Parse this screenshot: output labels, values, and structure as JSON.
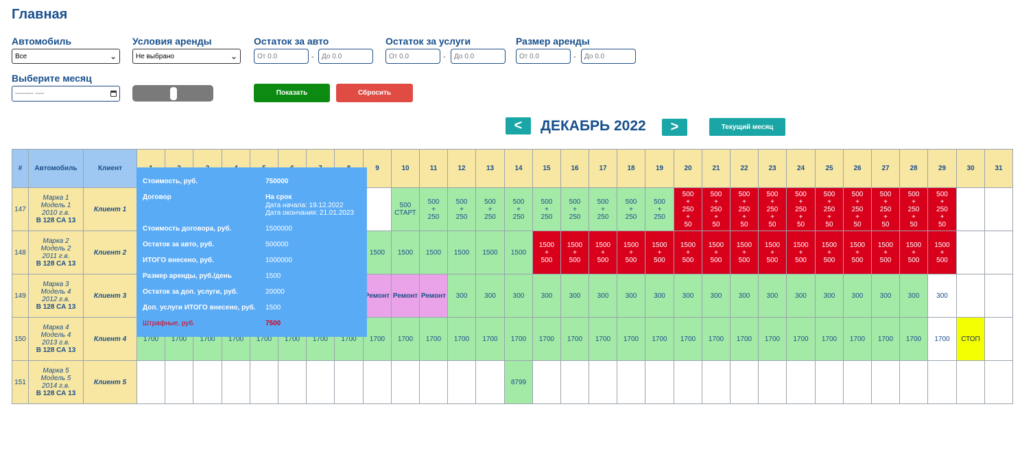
{
  "page": {
    "title": "Главная"
  },
  "filters": {
    "car_label": "Автомобиль",
    "car_value": "Все",
    "terms_label": "Условия аренды",
    "terms_value": "Не выбрано",
    "car_rest_label": "Остаток за авто",
    "services_rest_label": "Остаток за услуги",
    "rent_size_label": "Размер аренды",
    "from_placeholder": "От 0.0",
    "to_placeholder": "До 0.0",
    "dash": "-",
    "month_label": "Выберите месяц",
    "month_value": "-------- ----",
    "show_button": "Показать",
    "reset_button": "Сбросить"
  },
  "calendar": {
    "prev": "<",
    "next": ">",
    "title": "ДЕКАБРЬ 2022",
    "current_button": "Текущий месяц"
  },
  "table": {
    "headers": {
      "id": "#",
      "car": "Автомобиль",
      "client": "Клиент"
    },
    "days": [
      "1",
      "2",
      "3",
      "4",
      "5",
      "6",
      "7",
      "8",
      "9",
      "10",
      "11",
      "12",
      "13",
      "14",
      "15",
      "16",
      "17",
      "18",
      "19",
      "20",
      "21",
      "22",
      "23",
      "24",
      "25",
      "26",
      "27",
      "28",
      "29",
      "30",
      "31"
    ],
    "rows": [
      {
        "id": "147",
        "car": [
          "Марка 1",
          "Модель 1",
          "2010 г.в."
        ],
        "plate": "В 128 СА 13",
        "client": "Клиент 1",
        "cells": [
          [
            "g",
            ""
          ],
          [
            "g",
            ""
          ],
          [
            "g",
            ""
          ],
          [
            "g",
            ""
          ],
          [
            "g",
            ""
          ],
          [
            "g",
            ""
          ],
          [
            "g",
            ""
          ],
          [
            "g",
            ""
          ],
          [
            "w",
            ""
          ],
          [
            "g",
            "500\nСТАРТ"
          ],
          [
            "g",
            "500\n+\n250"
          ],
          [
            "g",
            "500\n+\n250"
          ],
          [
            "g",
            "500\n+\n250"
          ],
          [
            "g",
            "500\n+\n250"
          ],
          [
            "g",
            "500\n+\n250"
          ],
          [
            "g",
            "500\n+\n250"
          ],
          [
            "g",
            "500\n+\n250"
          ],
          [
            "g",
            "500\n+\n250"
          ],
          [
            "g",
            "500\n+\n250"
          ],
          [
            "r",
            "500\n+\n250\n+\n50"
          ],
          [
            "r",
            "500\n+\n250\n+\n50"
          ],
          [
            "r",
            "500\n+\n250\n+\n50"
          ],
          [
            "r",
            "500\n+\n250\n+\n50"
          ],
          [
            "r",
            "500\n+\n250\n+\n50"
          ],
          [
            "r",
            "500\n+\n250\n+\n50"
          ],
          [
            "r",
            "500\n+\n250\n+\n50"
          ],
          [
            "r",
            "500\n+\n250\n+\n50"
          ],
          [
            "r",
            "500\n+\n250\n+\n50"
          ],
          [
            "r",
            "500\n+\n250\n+\n50"
          ],
          [
            "w",
            ""
          ],
          [
            "w",
            ""
          ]
        ]
      },
      {
        "id": "148",
        "car": [
          "Марка 2",
          "Модель 2",
          "2011 г.в."
        ],
        "plate": "В 128 СА 13",
        "client": "Клиент 2",
        "cells": [
          [
            "g",
            ""
          ],
          [
            "g",
            ""
          ],
          [
            "g",
            ""
          ],
          [
            "g",
            ""
          ],
          [
            "g",
            ""
          ],
          [
            "g",
            ""
          ],
          [
            "g",
            ""
          ],
          [
            "g",
            ""
          ],
          [
            "g",
            "1500"
          ],
          [
            "g",
            "1500"
          ],
          [
            "g",
            "1500"
          ],
          [
            "g",
            "1500"
          ],
          [
            "g",
            "1500"
          ],
          [
            "g",
            "1500"
          ],
          [
            "r",
            "1500\n+\n500"
          ],
          [
            "r",
            "1500\n+\n500"
          ],
          [
            "r",
            "1500\n+\n500"
          ],
          [
            "r",
            "1500\n+\n500"
          ],
          [
            "r",
            "1500\n+\n500"
          ],
          [
            "r",
            "1500\n+\n500"
          ],
          [
            "r",
            "1500\n+\n500"
          ],
          [
            "r",
            "1500\n+\n500"
          ],
          [
            "r",
            "1500\n+\n500"
          ],
          [
            "r",
            "1500\n+\n500"
          ],
          [
            "r",
            "1500\n+\n500"
          ],
          [
            "r",
            "1500\n+\n500"
          ],
          [
            "r",
            "1500\n+\n500"
          ],
          [
            "r",
            "1500\n+\n500"
          ],
          [
            "r",
            "1500\n+\n500"
          ],
          [
            "w",
            ""
          ],
          [
            "w",
            ""
          ]
        ]
      },
      {
        "id": "149",
        "car": [
          "Марка 3",
          "Модель 4",
          "2012 г.в."
        ],
        "plate": "В 128 СА 13",
        "client": "Клиент 3",
        "cells": [
          [
            "g",
            ""
          ],
          [
            "g",
            ""
          ],
          [
            "g",
            ""
          ],
          [
            "g",
            ""
          ],
          [
            "g",
            ""
          ],
          [
            "g",
            ""
          ],
          [
            "g",
            ""
          ],
          [
            "g",
            ""
          ],
          [
            "p",
            "Ремонт"
          ],
          [
            "p",
            "Ремонт"
          ],
          [
            "p",
            "Ремонт"
          ],
          [
            "g",
            "300"
          ],
          [
            "g",
            "300"
          ],
          [
            "g",
            "300"
          ],
          [
            "g",
            "300"
          ],
          [
            "g",
            "300"
          ],
          [
            "g",
            "300"
          ],
          [
            "g",
            "300"
          ],
          [
            "g",
            "300"
          ],
          [
            "g",
            "300"
          ],
          [
            "g",
            "300"
          ],
          [
            "g",
            "300"
          ],
          [
            "g",
            "300"
          ],
          [
            "g",
            "300"
          ],
          [
            "g",
            "300"
          ],
          [
            "g",
            "300"
          ],
          [
            "g",
            "300"
          ],
          [
            "g",
            "300"
          ],
          [
            "w",
            "300"
          ],
          [
            "w",
            ""
          ],
          [
            "w",
            ""
          ]
        ]
      },
      {
        "id": "150",
        "car": [
          "Марка 4",
          "Модель 4",
          "2013 г.в."
        ],
        "plate": "В 128 СА 13",
        "client": "Клиент 4",
        "cells": [
          [
            "g",
            "1700"
          ],
          [
            "g",
            "1700"
          ],
          [
            "g",
            "1700"
          ],
          [
            "g",
            "1700"
          ],
          [
            "g",
            "1700"
          ],
          [
            "g",
            "1700"
          ],
          [
            "g",
            "1700"
          ],
          [
            "g",
            "1700"
          ],
          [
            "g",
            "1700"
          ],
          [
            "g",
            "1700"
          ],
          [
            "g",
            "1700"
          ],
          [
            "g",
            "1700"
          ],
          [
            "g",
            "1700"
          ],
          [
            "g",
            "1700"
          ],
          [
            "g",
            "1700"
          ],
          [
            "g",
            "1700"
          ],
          [
            "g",
            "1700"
          ],
          [
            "g",
            "1700"
          ],
          [
            "g",
            "1700"
          ],
          [
            "g",
            "1700"
          ],
          [
            "g",
            "1700"
          ],
          [
            "g",
            "1700"
          ],
          [
            "g",
            "1700"
          ],
          [
            "g",
            "1700"
          ],
          [
            "g",
            "1700"
          ],
          [
            "g",
            "1700"
          ],
          [
            "g",
            "1700"
          ],
          [
            "g",
            "1700"
          ],
          [
            "w",
            "1700"
          ],
          [
            "y",
            "СТОП"
          ],
          [
            "w",
            ""
          ]
        ]
      },
      {
        "id": "151",
        "car": [
          "Марка 5",
          "Модель 5",
          "2014 г.в."
        ],
        "plate": "В 128 СА 13",
        "client": "Клиент 5",
        "cells": [
          [
            "w",
            ""
          ],
          [
            "w",
            ""
          ],
          [
            "w",
            ""
          ],
          [
            "w",
            ""
          ],
          [
            "w",
            ""
          ],
          [
            "w",
            ""
          ],
          [
            "w",
            ""
          ],
          [
            "w",
            ""
          ],
          [
            "w",
            ""
          ],
          [
            "w",
            ""
          ],
          [
            "w",
            ""
          ],
          [
            "w",
            ""
          ],
          [
            "w",
            ""
          ],
          [
            "g",
            "8799"
          ],
          [
            "w",
            ""
          ],
          [
            "w",
            ""
          ],
          [
            "w",
            ""
          ],
          [
            "w",
            ""
          ],
          [
            "w",
            ""
          ],
          [
            "w",
            ""
          ],
          [
            "w",
            ""
          ],
          [
            "w",
            ""
          ],
          [
            "w",
            ""
          ],
          [
            "w",
            ""
          ],
          [
            "w",
            ""
          ],
          [
            "w",
            ""
          ],
          [
            "w",
            ""
          ],
          [
            "w",
            ""
          ],
          [
            "w",
            ""
          ],
          [
            "w",
            ""
          ],
          [
            "w",
            ""
          ]
        ]
      }
    ]
  },
  "tooltip": {
    "cost_label": "Стоимость, руб.",
    "cost_value": "750000",
    "contract_label": "Договор",
    "contract_value": "На срок",
    "start_date": "Дата начала: 19.12.2022",
    "end_date": "Дата окончания: 21.01.2023",
    "contract_cost_label": "Стоимость договора, руб.",
    "contract_cost_value": "1500000",
    "car_rest_label": "Остаток за авто, руб.",
    "car_rest_value": "500000",
    "total_paid_label": "ИТОГО внесено, руб.",
    "total_paid_value": "1000000",
    "rent_label": "Размер аренды, руб./день",
    "rent_value": "1500",
    "services_rest_label": "Остаток за доп. услуги, руб.",
    "services_rest_value": "20000",
    "services_paid_label": "Доп. услуги ИТОГО внесено, руб.",
    "services_paid_value": "1500",
    "penalty_label": "Штрафные, руб.",
    "penalty_value": "7500"
  },
  "colors": {
    "green": "#a3eaa7",
    "red": "#d9001b",
    "pink": "#eaa3e8",
    "yellow": "#f3ff00",
    "header": "#f8e7a3",
    "accent": "#1aa6a6",
    "tooltip": "#5aabf5"
  }
}
